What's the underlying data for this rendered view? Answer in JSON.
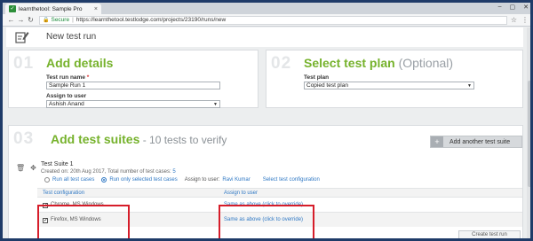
{
  "browser": {
    "tab_title": "learnthetool: Sample Pro",
    "tab_close": "×",
    "secure_label": "Secure",
    "url": "https://learnthetool.testlodge.com/projects/23190/runs/new"
  },
  "header": {
    "title": "New test run"
  },
  "details": {
    "step": "01",
    "title": "Add details",
    "run_name_label": "Test run name",
    "run_name_required": "*",
    "run_name_value": "Sample Run 1",
    "assign_label": "Assign to user",
    "assign_value": "Ashish Anand"
  },
  "plan": {
    "step": "02",
    "title": "Select test plan",
    "optional": "(Optional)",
    "plan_label": "Test plan",
    "plan_value": "Copied test plan"
  },
  "suites": {
    "step": "03",
    "title": "Add test suites",
    "subtitle": " - 10 tests to verify",
    "add_button": "Add another test suite",
    "suite_name": "Test Suite 1",
    "created_prefix": "Created on: 20th Aug 2017, Total number of test cases: ",
    "created_count": "5",
    "radio_all": "Run all test cases",
    "radio_selected": "Run only selected test cases",
    "assign_prefix": "Assign to user:",
    "assign_user": "Ravi Kumar",
    "select_config": "Select test configuration",
    "table": {
      "col_config": "Test configuration",
      "col_assign": "Assign to user",
      "rows": [
        {
          "config": "Chrome, MS Windows",
          "assign": "Same as above (click to override)"
        },
        {
          "config": "Firefox, MS Windows",
          "assign": "Same as above (click to override)"
        }
      ]
    },
    "create_button": "Create test run"
  },
  "colors": {
    "accent_green": "#76b22c",
    "link_blue": "#2f78c4",
    "highlight_red": "#d61d2a"
  }
}
